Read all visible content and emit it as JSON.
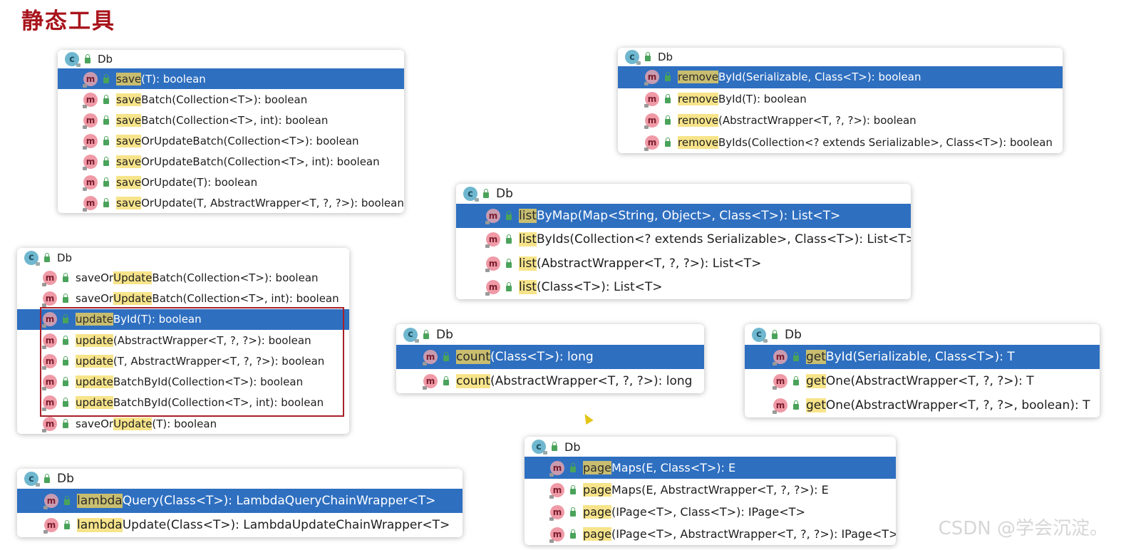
{
  "page_title": "静态工具",
  "watermark": "CSDN @学会沉淀。",
  "popups": [
    {
      "id": "save",
      "header": "Db",
      "rows": [
        {
          "hl": "save",
          "rest": "(T): boolean",
          "selected": true
        },
        {
          "hl": "save",
          "rest": "Batch(Collection<T>): boolean"
        },
        {
          "hl": "save",
          "rest": "Batch(Collection<T>, int): boolean"
        },
        {
          "hl": "save",
          "rest": "OrUpdateBatch(Collection<T>): boolean"
        },
        {
          "hl": "save",
          "rest": "OrUpdateBatch(Collection<T>, int): boolean"
        },
        {
          "hl": "save",
          "rest": "OrUpdate(T): boolean"
        },
        {
          "hl": "save",
          "rest": "OrUpdate(T, AbstractWrapper<T, ?, ?>): boolean"
        }
      ]
    },
    {
      "id": "update",
      "header": "Db",
      "rows": [
        {
          "pre": "saveOr",
          "hl": "Update",
          "rest": "Batch(Collection<T>): boolean"
        },
        {
          "pre": "saveOr",
          "hl": "Update",
          "rest": "Batch(Collection<T>, int): boolean"
        },
        {
          "hl": "update",
          "rest": "ById(T): boolean",
          "selected": true
        },
        {
          "hl": "update",
          "rest": "(AbstractWrapper<T, ?, ?>): boolean"
        },
        {
          "hl": "update",
          "rest": "(T, AbstractWrapper<T, ?, ?>): boolean"
        },
        {
          "hl": "update",
          "rest": "BatchById(Collection<T>): boolean"
        },
        {
          "hl": "update",
          "rest": "BatchById(Collection<T>, int): boolean"
        },
        {
          "pre": "saveOr",
          "hl": "Update",
          "rest": "(T): boolean"
        }
      ]
    },
    {
      "id": "lambda",
      "header": "Db",
      "rows": [
        {
          "hl": "lambda",
          "rest": "Query(Class<T>): LambdaQueryChainWrapper<T>",
          "selected": true
        },
        {
          "hl": "lambda",
          "rest": "Update(Class<T>): LambdaUpdateChainWrapper<T>"
        }
      ]
    },
    {
      "id": "remove",
      "header": "Db",
      "rows": [
        {
          "hl": "remove",
          "rest": "ById(Serializable, Class<T>): boolean",
          "selected": true
        },
        {
          "hl": "remove",
          "rest": "ById(T): boolean"
        },
        {
          "hl": "remove",
          "rest": "(AbstractWrapper<T, ?, ?>): boolean"
        },
        {
          "hl": "remove",
          "rest": "ByIds(Collection<? extends Serializable>, Class<T>): boolean"
        }
      ]
    },
    {
      "id": "list",
      "header": "Db",
      "rows": [
        {
          "hl": "list",
          "rest": "ByMap(Map<String, Object>, Class<T>): List<T>",
          "selected": true
        },
        {
          "hl": "list",
          "rest": "ByIds(Collection<? extends Serializable>, Class<T>): List<T>"
        },
        {
          "hl": "list",
          "rest": "(AbstractWrapper<T, ?, ?>): List<T>"
        },
        {
          "hl": "list",
          "rest": "(Class<T>): List<T>"
        }
      ]
    },
    {
      "id": "count",
      "header": "Db",
      "rows": [
        {
          "hl": "count",
          "rest": "(Class<T>): long",
          "selected": true
        },
        {
          "hl": "count",
          "rest": "(AbstractWrapper<T, ?, ?>): long"
        }
      ]
    },
    {
      "id": "get",
      "header": "Db",
      "rows": [
        {
          "hl": "get",
          "rest": "ById(Serializable, Class<T>): T",
          "selected": true
        },
        {
          "hl": "get",
          "rest": "One(AbstractWrapper<T, ?, ?>): T"
        },
        {
          "hl": "get",
          "rest": "One(AbstractWrapper<T, ?, ?>, boolean): T"
        }
      ]
    },
    {
      "id": "page",
      "header": "Db",
      "rows": [
        {
          "hl": "page",
          "rest": "Maps(E, Class<T>): E",
          "selected": true
        },
        {
          "hl": "page",
          "rest": "Maps(E, AbstractWrapper<T, ?, ?>): E"
        },
        {
          "hl": "page",
          "rest": "(IPage<T>, Class<T>): IPage<T>"
        },
        {
          "hl": "page",
          "rest": "(IPage<T>, AbstractWrapper<T, ?, ?>): IPage<T>"
        }
      ]
    }
  ]
}
